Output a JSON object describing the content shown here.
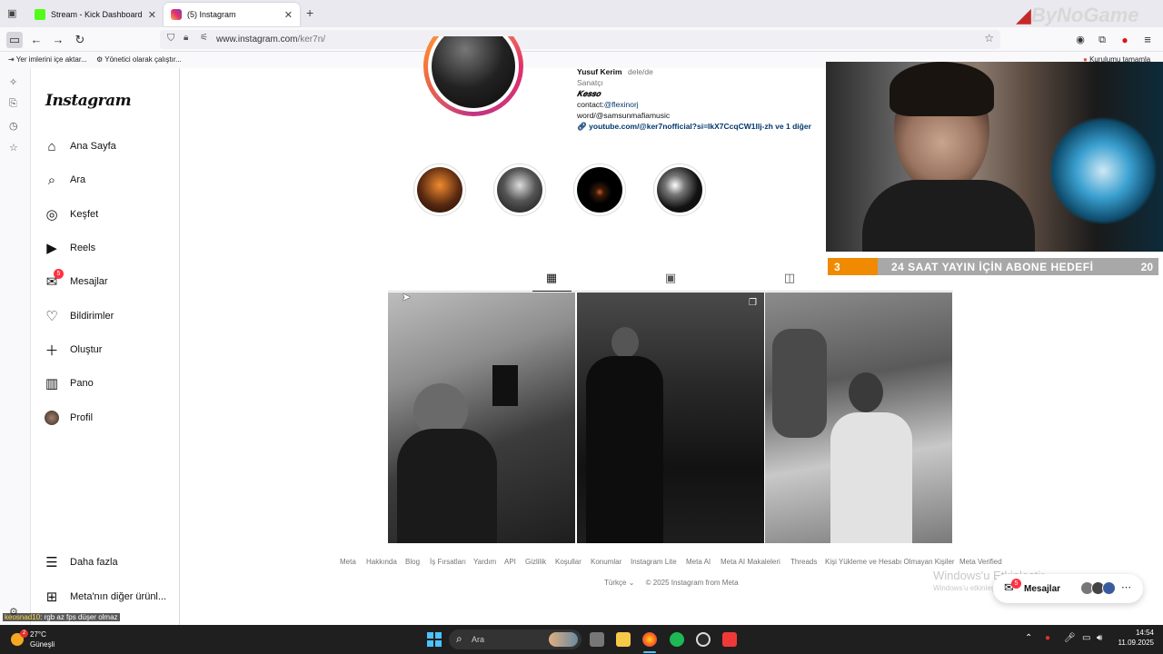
{
  "browser": {
    "tabs": [
      {
        "label": "Stream - Kick Dashboard",
        "favicon_color": "#53fc18"
      },
      {
        "label": "(5) Instagram",
        "favicon_color": "#e1306c"
      }
    ],
    "url_domain": "www.instagram.com",
    "url_path": "/ker7n/",
    "bookmarks": [
      "Yer imlerini içe aktar...",
      "Yönetici olarak çalıştır..."
    ],
    "extension_label": "Kurulumu tamamla",
    "watermark": "ByNoGame"
  },
  "instagram": {
    "logo": "Instagram",
    "nav": [
      {
        "label": "Ana Sayfa",
        "icon": "home-icon"
      },
      {
        "label": "Ara",
        "icon": "search-icon"
      },
      {
        "label": "Keşfet",
        "icon": "compass-icon"
      },
      {
        "label": "Reels",
        "icon": "reels-icon"
      },
      {
        "label": "Mesajlar",
        "icon": "messenger-icon",
        "badge": "5"
      },
      {
        "label": "Bildirimler",
        "icon": "heart-icon"
      },
      {
        "label": "Oluştur",
        "icon": "plus-icon"
      },
      {
        "label": "Pano",
        "icon": "dashboard-icon"
      },
      {
        "label": "Profil",
        "icon": "avatar-icon"
      }
    ],
    "more": "Daha fazla",
    "meta_more": "Meta'nın diğer ürünl...",
    "profile": {
      "name": "Yusuf Kerim",
      "pronouns": "dele/de",
      "category": "Sanatçı",
      "bio_title": "𝑲𝒆𝒔𝒔𝒐",
      "contact_prefix": "contact:",
      "contact_handle": "@flexinorj",
      "word_line": "word/@samsunmafiamusic",
      "link": "youtube.com/@ker7nofficial?si=IkX7CcqCW1llj-zh ve 1 diğer"
    },
    "footer_links": [
      "Meta",
      "Hakkında",
      "Blog",
      "İş Fırsatları",
      "Yardım",
      "API",
      "Gizlilik",
      "Koşullar",
      "Konumlar",
      "Instagram Lite",
      "Meta AI",
      "Meta AI Makaleleri",
      "Threads",
      "Kişi Yükleme ve Hesabı Olmayan Kişiler",
      "Meta Verified"
    ],
    "language": "Türkçe",
    "copyright": "© 2025 Instagram from Meta",
    "messages_popup": {
      "label": "Mesajlar",
      "badge": "5"
    }
  },
  "stream_overlay": {
    "sub_goal_current": "3",
    "sub_goal_text": "24 SAAT YAYIN İÇİN ABONE HEDEFİ",
    "sub_goal_target": "20",
    "sub_goal_progress": 0.15,
    "chat_user": "keosnad10",
    "chat_message": ": rgb az fps düşer olmaz"
  },
  "windows": {
    "activate_line1": "Windows'u Etkinleştir",
    "activate_line2": "Windows'u etkinleştirmek için Ayarlar'a gidin",
    "weather_temp": "27°C",
    "weather_desc": "Güneşli",
    "weather_badge": "2",
    "search_placeholder": "Ara",
    "time": "14:54",
    "date": "11.09.2025"
  },
  "colors": {
    "accent": "#0095f6",
    "badge": "#ff3040",
    "goal_orange": "#f08a00"
  }
}
